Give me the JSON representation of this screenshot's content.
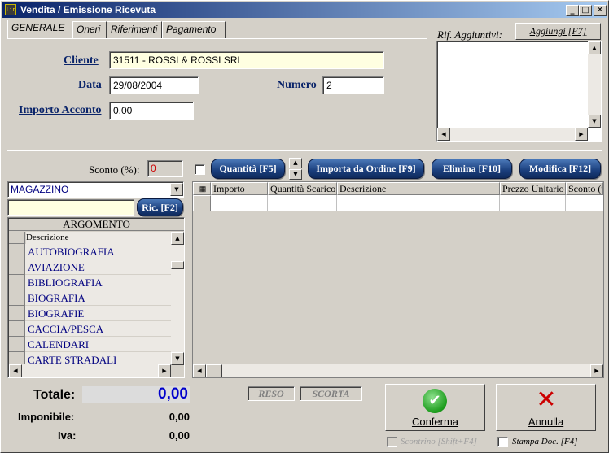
{
  "window": {
    "title": "Vendita / Emissione Ricevuta",
    "app_icon_text": "lin",
    "minimize": "_",
    "maximize": "□",
    "close": "✕"
  },
  "tabs": [
    {
      "label": "GENERALE",
      "active": true
    },
    {
      "label": "Oneri"
    },
    {
      "label": "Riferimenti"
    },
    {
      "label": "Pagamento"
    }
  ],
  "form": {
    "cliente_label": "Cliente",
    "cliente_value": "31511 - ROSSI & ROSSI SRL",
    "data_label": "Data",
    "data_value": "29/08/2004",
    "numero_label": "Numero",
    "numero_value": "2",
    "acconto_label": "Importo Acconto",
    "acconto_value": "0,00"
  },
  "rif": {
    "label": "Rif. Aggiuntivi:",
    "button": "Aggiungi  [F7]",
    "text": ""
  },
  "left_panel": {
    "sconto_label": "Sconto (%):",
    "sconto_value": "0",
    "magazzino_value": "MAGAZZINO",
    "search_value": "",
    "ric_button": "Ric. [F2]",
    "list_title": "ARGOMENTO",
    "list_header": "Descrizione",
    "items": [
      "AUTOBIOGRAFIA",
      "AVIAZIONE",
      "BIBLIOGRAFIA",
      "BIOGRAFIA",
      "BIOGRAFIE",
      "CACCIA/PESCA",
      "CALENDARI",
      "CARTE STRADALI"
    ]
  },
  "toolbar": {
    "quantita": "Quantità [F5]",
    "importa": "Importa da Ordine [F9]",
    "elimina": "Elimina [F10]",
    "modifica": "Modifica [F12]"
  },
  "grid": {
    "columns": [
      "Importo",
      "Quantità Scarico",
      "Descrizione",
      "Prezzo Unitario",
      "Sconto (%)"
    ]
  },
  "totals": {
    "totale_label": "Totale:",
    "totale_value": "0,00",
    "imponibile_label": "Imponibile:",
    "imponibile_value": "0,00",
    "iva_label": "Iva:",
    "iva_value": "0,00",
    "reso": "RESO",
    "scorta": "SCORTA"
  },
  "actions": {
    "conferma": "Conferma",
    "annulla": "Annulla",
    "scontrino": "Scontrino [Shift+F4]",
    "stampa": "Stampa Doc. [F4]"
  },
  "colors": {
    "title_start": "#0a246a",
    "title_end": "#a6caf0",
    "button_blue": "#1a3e7c",
    "list_text": "#000080",
    "total_value": "#0000cc",
    "sconto_red": "#cc0000"
  }
}
